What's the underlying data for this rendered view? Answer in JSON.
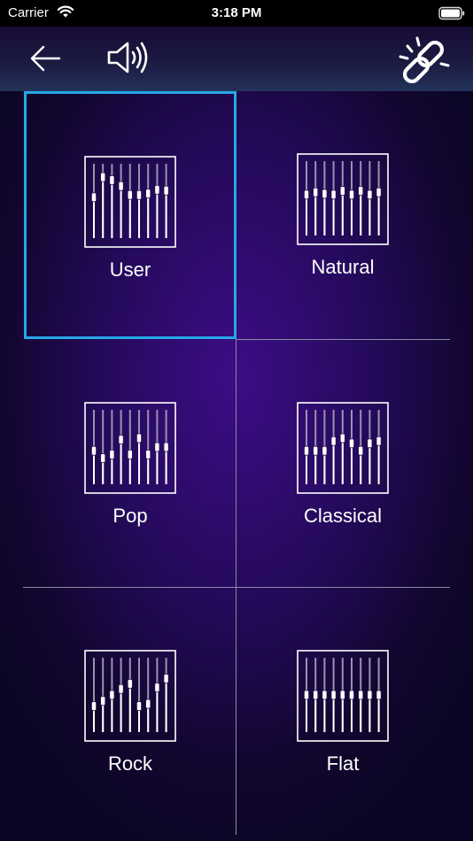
{
  "status_bar": {
    "carrier": "Carrier",
    "time": "3:18 PM"
  },
  "nav": {
    "back_icon": "back-arrow-icon",
    "speaker_icon": "speaker-icon",
    "link_icon": "broken-link-icon"
  },
  "colors": {
    "selection": "#27a8e8",
    "divider": "#8a8aa0",
    "background_center": "#3c0d86"
  },
  "presets": [
    {
      "label": "User",
      "selected": true,
      "levels": [
        0.55,
        0.82,
        0.78,
        0.7,
        0.58,
        0.58,
        0.6,
        0.65,
        0.64
      ]
    },
    {
      "label": "Natural",
      "selected": false,
      "levels": [
        0.55,
        0.58,
        0.56,
        0.55,
        0.6,
        0.55,
        0.6,
        0.55,
        0.58
      ]
    },
    {
      "label": "Pop",
      "selected": false,
      "levels": [
        0.45,
        0.35,
        0.4,
        0.6,
        0.4,
        0.62,
        0.4,
        0.5,
        0.5
      ]
    },
    {
      "label": "Classical",
      "selected": false,
      "levels": [
        0.45,
        0.45,
        0.45,
        0.58,
        0.62,
        0.55,
        0.45,
        0.55,
        0.58
      ]
    },
    {
      "label": "Rock",
      "selected": false,
      "levels": [
        0.35,
        0.42,
        0.5,
        0.58,
        0.65,
        0.35,
        0.38,
        0.6,
        0.72
      ]
    },
    {
      "label": "Flat",
      "selected": false,
      "levels": [
        0.5,
        0.5,
        0.5,
        0.5,
        0.5,
        0.5,
        0.5,
        0.5,
        0.5
      ]
    }
  ]
}
